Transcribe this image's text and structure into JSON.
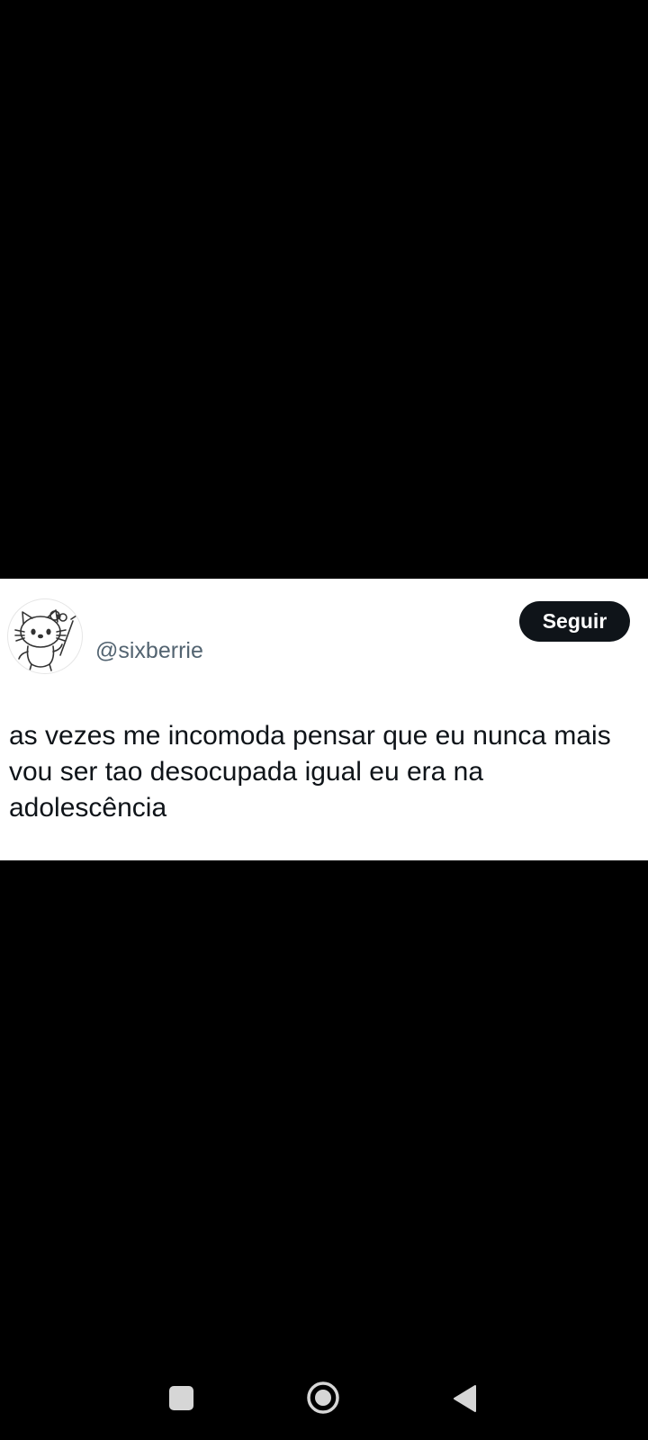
{
  "tweet": {
    "handle": "@sixberrie",
    "follow_label": "Seguir",
    "text_lines": [
      "as vezes me incomoda pensar que eu nunca mais",
      "vou ser tao desocupada igual eu era na",
      "adolescência"
    ],
    "avatar_icon": "hello-kitty-avatar-icon"
  },
  "nav_bar": {
    "buttons": [
      "recents-icon",
      "home-icon",
      "back-icon"
    ]
  },
  "colors": {
    "background": "#000000",
    "card": "#ffffff",
    "follow_button": "#0f1419",
    "handle": "#536471",
    "text": "#0f1419",
    "nav_icons": "#d6d6d6"
  }
}
